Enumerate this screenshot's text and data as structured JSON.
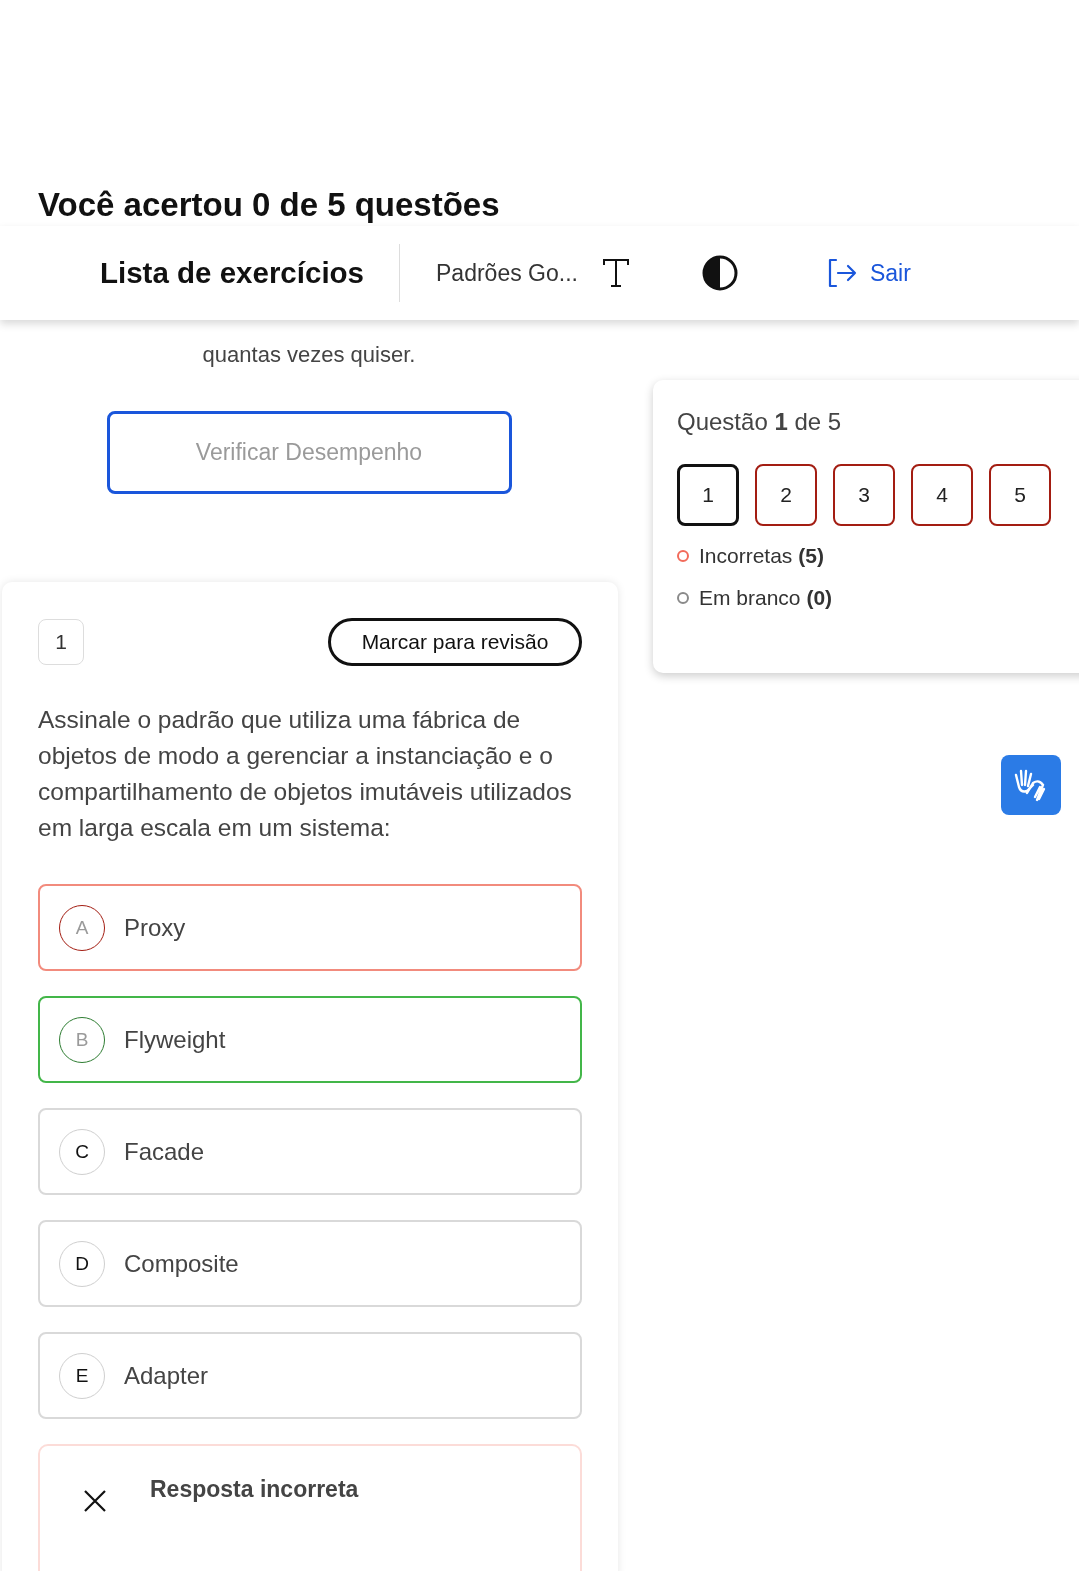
{
  "result_title": "Você acertou 0 de 5 questões",
  "header": {
    "title": "Lista de exercícios",
    "course": "Padrões Go...",
    "exit_label": "Sair"
  },
  "intro_tail": "quantas vezes quiser.",
  "check_button": {
    "label": "Verificar Desempenho",
    "disabled": true
  },
  "question": {
    "number": "1",
    "review_button": "Marcar para revisão",
    "text": "Assinale o padrão que utiliza uma fábrica de objetos de modo a gerenciar a instanciação e o compartilhamento de objetos imutáveis utilizados em larga escala em um sistema:",
    "options": [
      {
        "letter": "A",
        "label": "Proxy",
        "kind": "incorrect"
      },
      {
        "letter": "B",
        "label": "Flyweight",
        "kind": "correct"
      },
      {
        "letter": "C",
        "label": "Facade",
        "kind": "neutral"
      },
      {
        "letter": "D",
        "label": "Composite",
        "kind": "neutral"
      },
      {
        "letter": "E",
        "label": "Adapter",
        "kind": "neutral"
      }
    ],
    "feedback": {
      "kind": "incorrect",
      "title": "Resposta incorreta"
    }
  },
  "navigator": {
    "heading": "Questão **1** de 5",
    "questions": [
      {
        "label": "1",
        "selected": true
      },
      {
        "label": "2",
        "selected": false,
        "kind": "incorrect"
      },
      {
        "label": "3",
        "selected": false,
        "kind": "incorrect"
      },
      {
        "label": "4",
        "selected": false,
        "kind": "incorrect"
      },
      {
        "label": "5",
        "selected": false,
        "kind": "incorrect"
      }
    ],
    "legend": [
      {
        "label": "Incorretas **(5)**",
        "color": "#f26b5b"
      },
      {
        "label": "Em branco **(0)**",
        "color": "#8a8a8a"
      }
    ]
  }
}
